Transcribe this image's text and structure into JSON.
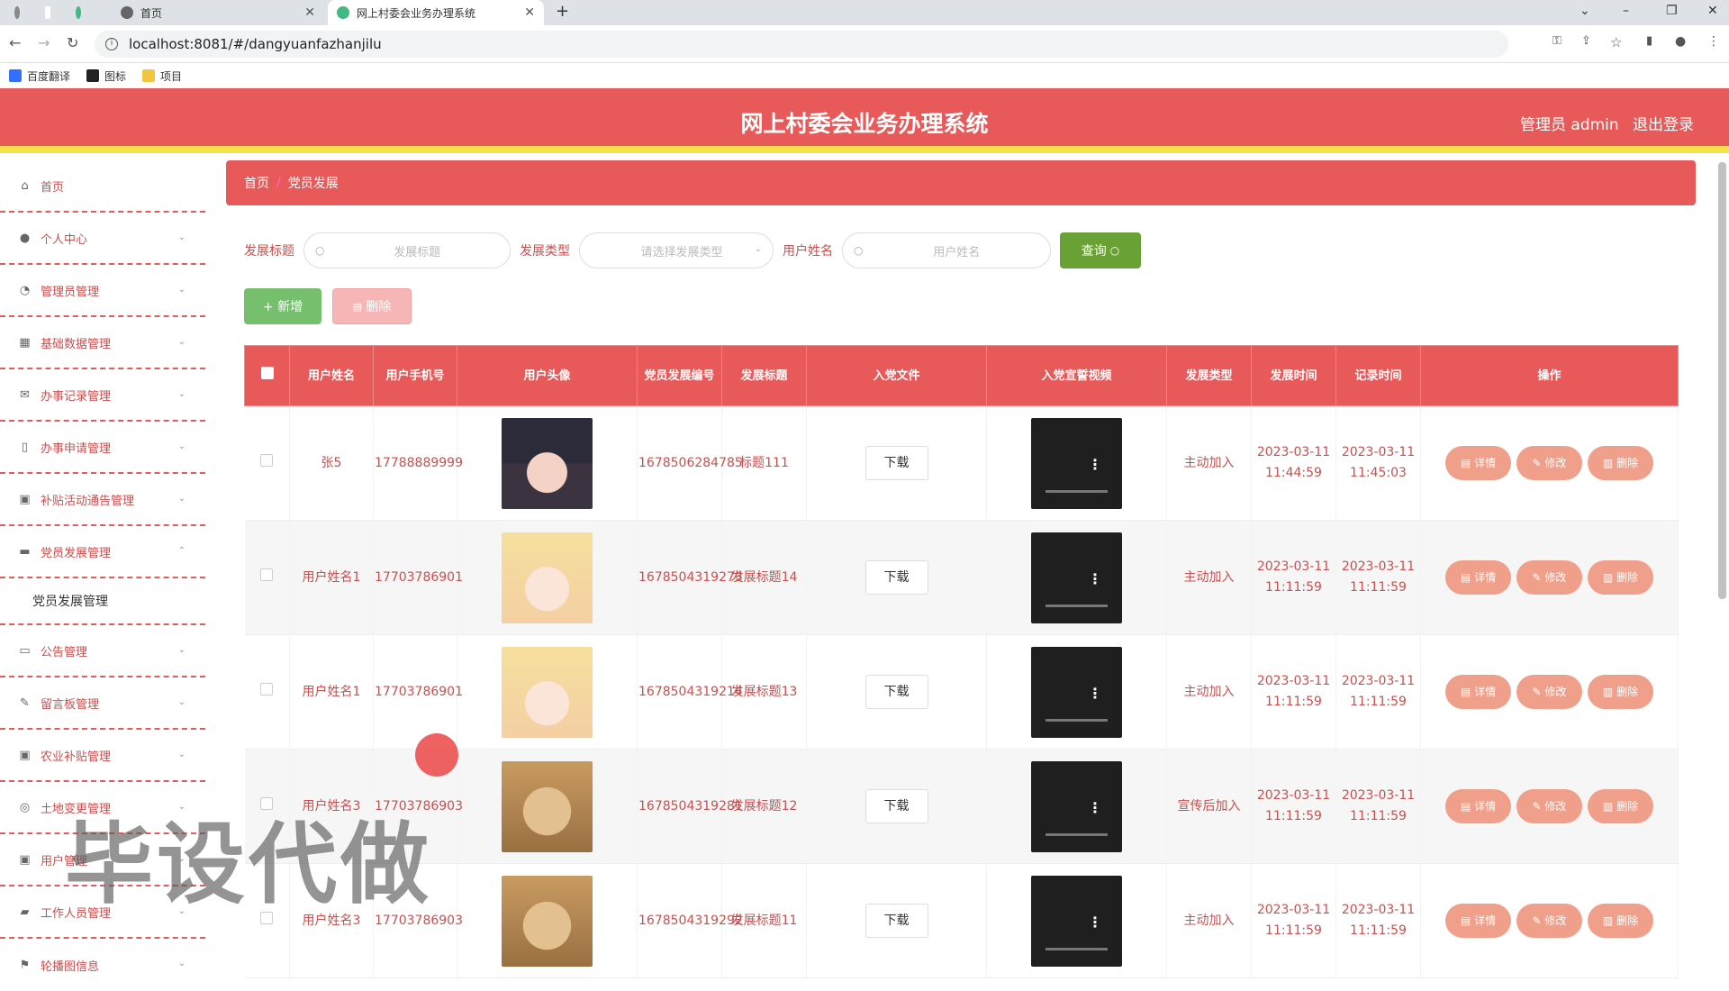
{
  "browser": {
    "tabs": [
      {
        "title": ""
      },
      {
        "title": ""
      },
      {
        "title": ""
      },
      {
        "title": "首页"
      },
      {
        "title": "网上村委会业务办理系统"
      }
    ],
    "url": "localhost:8081/#/dangyuanfazhanjilu",
    "bookmarks": [
      "百度翻译",
      "图标",
      "项目"
    ]
  },
  "header": {
    "title": "网上村委会业务办理系统",
    "user": "管理员 admin",
    "logout": "退出登录"
  },
  "sidebar": {
    "items": [
      {
        "label": "首页",
        "icon": "home-icon"
      },
      {
        "label": "个人中心",
        "icon": "user-icon"
      },
      {
        "label": "管理员管理",
        "icon": "dashboard-icon"
      },
      {
        "label": "基础数据管理",
        "icon": "grid-icon"
      },
      {
        "label": "办事记录管理",
        "icon": "mail-icon"
      },
      {
        "label": "办事申请管理",
        "icon": "phone-icon"
      },
      {
        "label": "补贴活动通告管理",
        "icon": "clipboard-icon"
      },
      {
        "label": "党员发展管理",
        "icon": "monitor-icon"
      },
      {
        "label": "党员发展管理",
        "icon": ""
      },
      {
        "label": "公告管理",
        "icon": "chat-icon"
      },
      {
        "label": "留言板管理",
        "icon": "pen-icon"
      },
      {
        "label": "农业补贴管理",
        "icon": "clipboard-icon"
      },
      {
        "label": "土地变更管理",
        "icon": "circle-icon"
      },
      {
        "label": "用户管理",
        "icon": "clipboard-icon"
      },
      {
        "label": "工作人员管理",
        "icon": "car-icon"
      },
      {
        "label": "轮播图信息",
        "icon": "flag-icon"
      }
    ]
  },
  "breadcrumb": {
    "home": "首页",
    "current": "党员发展"
  },
  "search": {
    "title_label": "发展标题",
    "title_placeholder": "发展标题",
    "type_label": "发展类型",
    "type_placeholder": "请选择发展类型",
    "name_label": "用户姓名",
    "name_placeholder": "用户姓名",
    "query": "查询"
  },
  "actions": {
    "add": "+ 新增",
    "delete": "删除"
  },
  "table": {
    "headers": [
      "用户姓名",
      "用户手机号",
      "用户头像",
      "党员发展编号",
      "发展标题",
      "入党文件",
      "入党宣誓视频",
      "发展类型",
      "发展时间",
      "记录时间",
      "操作"
    ],
    "download": "下载",
    "op_detail": "详情",
    "op_edit": "修改",
    "op_delete": "删除",
    "rows": [
      {
        "name": "张5",
        "phone": "17788889999",
        "avatar": "photo",
        "no": "1678506284785",
        "title": "标题111",
        "type": "主动加入",
        "dev_time": "2023-03-11 11:44:59",
        "rec_time": "2023-03-11 11:45:03"
      },
      {
        "name": "用户姓名1",
        "phone": "17703786901",
        "avatar": "anime",
        "no": "1678504319273",
        "title": "发展标题14",
        "type": "主动加入",
        "dev_time": "2023-03-11 11:11:59",
        "rec_time": "2023-03-11 11:11:59"
      },
      {
        "name": "用户姓名1",
        "phone": "17703786901",
        "avatar": "anime",
        "no": "1678504319214",
        "title": "发展标题13",
        "type": "主动加入",
        "dev_time": "2023-03-11 11:11:59",
        "rec_time": "2023-03-11 11:11:59"
      },
      {
        "name": "用户姓名3",
        "phone": "17703786903",
        "avatar": "dog",
        "no": "1678504319281",
        "title": "发展标题12",
        "type": "宣传后加入",
        "dev_time": "2023-03-11 11:11:59",
        "rec_time": "2023-03-11 11:11:59"
      },
      {
        "name": "用户姓名3",
        "phone": "17703786903",
        "avatar": "dog",
        "no": "1678504319292",
        "title": "发展标题11",
        "type": "主动加入",
        "dev_time": "2023-03-11 11:11:59",
        "rec_time": "2023-03-11 11:11:59"
      }
    ]
  },
  "watermark": "毕设代做",
  "colors": {
    "primary": "#e85a5a",
    "accent": "#f6e14b",
    "query": "#6aa135",
    "add": "#76c06d",
    "op": "#f0a08a"
  }
}
